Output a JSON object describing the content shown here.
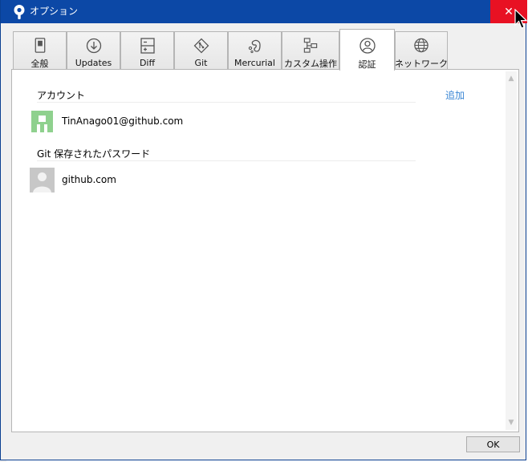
{
  "window": {
    "title": "オプション",
    "close_glyph": "✕"
  },
  "tabs": [
    {
      "label": "全般",
      "icon": "switch-icon"
    },
    {
      "label": "Updates",
      "icon": "download-icon"
    },
    {
      "label": "Diff",
      "icon": "diff-icon"
    },
    {
      "label": "Git",
      "icon": "git-icon"
    },
    {
      "label": "Mercurial",
      "icon": "mercurial-icon"
    },
    {
      "label": "カスタム操作",
      "icon": "custom-actions-icon"
    },
    {
      "label": "認証",
      "icon": "user-icon",
      "active": true
    },
    {
      "label": "ネットワーク",
      "icon": "globe-icon"
    }
  ],
  "accounts": {
    "header": "アカウント",
    "add_label": "追加",
    "items": [
      {
        "name": "TinAnago01@github.com",
        "avatar_color": "#8fd18e"
      }
    ]
  },
  "passwords": {
    "header": "Git 保存されたパスワード",
    "items": [
      {
        "name": "github.com"
      }
    ]
  },
  "footer": {
    "ok_label": "OK"
  },
  "colors": {
    "titlebar": "#0c48a6",
    "close": "#e81123",
    "link": "#3a86d4"
  }
}
